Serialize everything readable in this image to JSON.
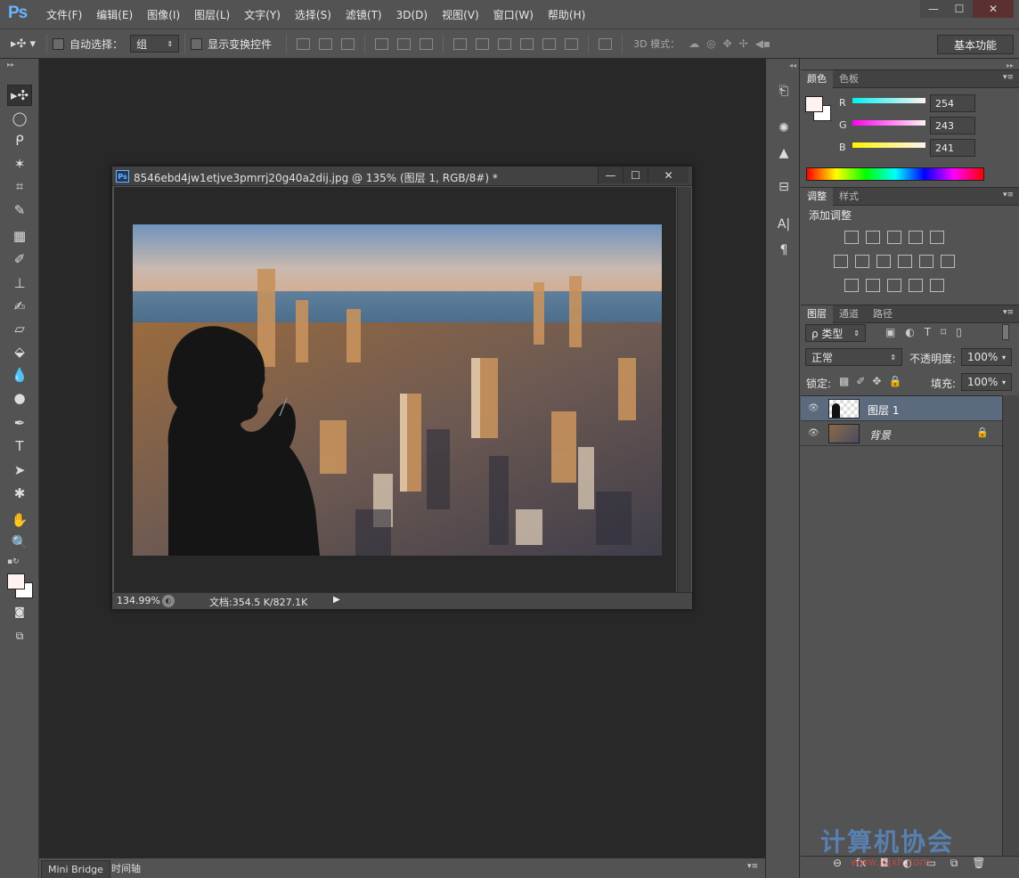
{
  "app": {
    "logo": "Ps"
  },
  "menu": [
    "文件(F)",
    "编辑(E)",
    "图像(I)",
    "图层(L)",
    "文字(Y)",
    "选择(S)",
    "滤镜(T)",
    "3D(D)",
    "视图(V)",
    "窗口(W)",
    "帮助(H)"
  ],
  "window_controls": {
    "minimize": "—",
    "maximize": "☐",
    "close": "✕"
  },
  "options": {
    "auto_select_label": "自动选择：",
    "auto_select_value": "组",
    "show_transform_label": "显示变换控件",
    "mode_3d_label": "3D 模式：",
    "workspace": "基本功能"
  },
  "document": {
    "title": "8546ebd4jw1etjve3pmrrj20g40a2dij.jpg @ 135% (图层 1, RGB/8#) *",
    "zoom": "134.99%",
    "doc_info": "文档:354.5 K/827.1K"
  },
  "bottom_tabs": [
    "Mini Bridge",
    "时间轴"
  ],
  "color_panel": {
    "tabs": [
      "颜色",
      "色板"
    ],
    "r_label": "R",
    "g_label": "G",
    "b_label": "B",
    "r": "254",
    "g": "243",
    "b": "241",
    "foreground_color": "#fef3f1"
  },
  "adjust_panel": {
    "tabs": [
      "调整",
      "样式"
    ],
    "add_label": "添加调整"
  },
  "layers_panel": {
    "tabs": [
      "图层",
      "通道",
      "路径"
    ],
    "filter_label": "ρ 类型",
    "blend_mode": "正常",
    "opacity_label": "不透明度:",
    "opacity": "100%",
    "lock_label": "锁定:",
    "fill_label": "填充:",
    "fill": "100%",
    "layers": [
      {
        "name": "图层 1",
        "selected": true
      },
      {
        "name": "背景",
        "selected": false,
        "locked": true
      }
    ]
  },
  "watermark": {
    "text": "计算机协会",
    "url": "www.jsjxh.com"
  }
}
